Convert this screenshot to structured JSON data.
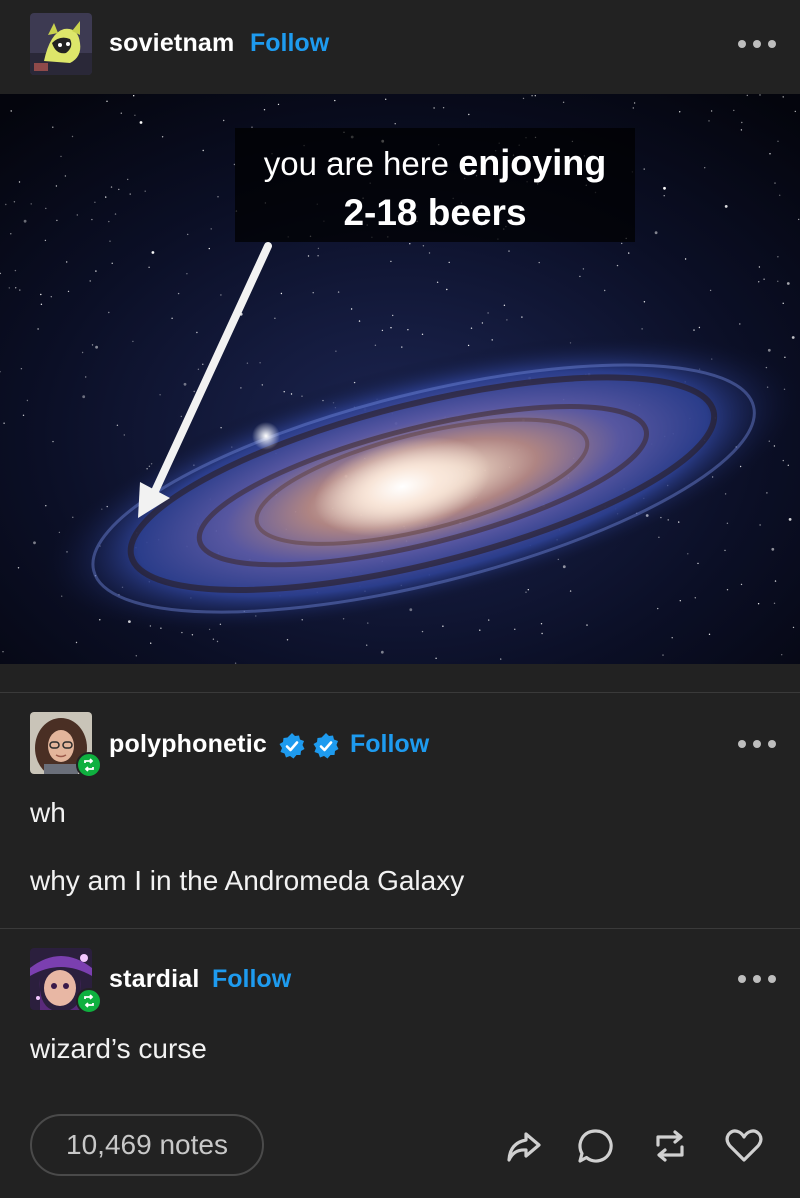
{
  "original_post": {
    "username": "sovietnam",
    "follow_label": "Follow",
    "avatar_icon": "avatar-sovietnam",
    "meme_line1_plain": "you are here",
    "meme_line1_bold": "enjoying",
    "meme_line2": "2-18 beers"
  },
  "reblog1": {
    "username": "polyphonetic",
    "follow_label": "Follow",
    "verified_badges": [
      "verified-check-icon",
      "verified-check-icon"
    ],
    "text_lines": [
      "wh",
      "why am I in the Andromeda Galaxy"
    ]
  },
  "reblog2": {
    "username": "stardial",
    "follow_label": "Follow",
    "text_lines": [
      "wizard’s curse"
    ]
  },
  "footer": {
    "notes_label": "10,469 notes",
    "actions": [
      "share-icon",
      "reply-icon",
      "reblog-icon",
      "heart-icon"
    ]
  },
  "colors": {
    "background": "#222222",
    "follow_blue": "#1e9bef",
    "reblog_green": "#0fb03f",
    "verified_blue": "#1e9bef"
  }
}
